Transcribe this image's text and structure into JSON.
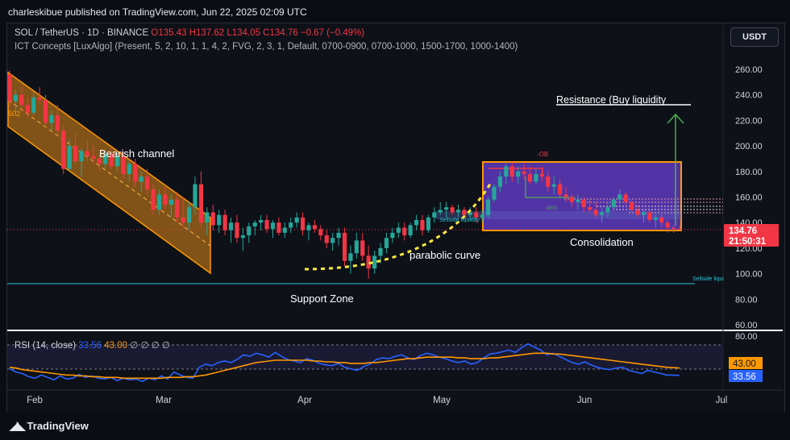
{
  "header": {
    "published": "charleskibue published on TradingView.com, Jun 22, 2025 02:09 UTC"
  },
  "legend": {
    "symbol": "SOL / TetherUS · 1D · BINANCE",
    "open": "O135.43",
    "high": "H137.62",
    "low": "L134.05",
    "close": "C134.76",
    "change": "−0.67 (−0.49%)",
    "indicator": "ICT Concepts [LuxAlgo] (Present, 5, 2, 10, 1, 1, 4, 2, FVG, 2, 3, 1, Default, 0700-0900, 0700-1000, 1500-1700, 1000-1400)"
  },
  "currency_button": "USDT",
  "annotations": {
    "bearish_channel": "Bearish channel",
    "support_zone": "Support Zone",
    "parabolic_curve": "parabolic curve",
    "consolidation": "Consolidation",
    "resistance": "Resistance (Buy liquidity",
    "ob": "-OB",
    "mss": "MSS",
    "sellside_liquidity": "Sellside liquidity",
    "sellside_liqui": "Sellside liqui",
    "fib_label": "502"
  },
  "price_badge": {
    "price": "134.76",
    "countdown": "21:50:31"
  },
  "rsi": {
    "label": "RSI (14, close)",
    "value": "33.56",
    "ma_value": "43.00",
    "extras": "∅ ∅ ∅ ∅",
    "badge_ma": "43.00",
    "badge_rsi": "33.56",
    "axis_top": "80.00"
  },
  "footer": {
    "brand": "TradingView"
  },
  "chart_data": {
    "type": "candlestick",
    "symbol": "SOL/USDT",
    "interval": "1D",
    "y_axis_ticks": [
      260,
      240,
      220,
      200,
      180,
      160,
      140,
      120,
      100,
      80,
      60
    ],
    "y_axis_tick_labels": [
      "260.00",
      "240.00",
      "220.00",
      "200.00",
      "180.00",
      "160.00",
      "140.00",
      "120.00",
      "100.00",
      "80.00",
      "60.00"
    ],
    "ylim": [
      55,
      272
    ],
    "x_tick_labels": [
      "Feb",
      "Mar",
      "Apr",
      "May",
      "Jun",
      "Jul"
    ],
    "last_price": 134.76,
    "candles": [
      [
        256,
        259,
        230,
        235
      ],
      [
        235,
        244,
        225,
        240
      ],
      [
        240,
        247,
        228,
        232
      ],
      [
        232,
        238,
        222,
        226
      ],
      [
        226,
        242,
        224,
        238
      ],
      [
        238,
        246,
        233,
        236
      ],
      [
        236,
        240,
        214,
        218
      ],
      [
        218,
        228,
        212,
        224
      ],
      [
        224,
        232,
        208,
        212
      ],
      [
        212,
        216,
        178,
        182
      ],
      [
        182,
        206,
        180,
        200
      ],
      [
        200,
        210,
        186,
        188
      ],
      [
        188,
        198,
        176,
        196
      ],
      [
        196,
        204,
        188,
        192
      ],
      [
        192,
        201,
        186,
        190
      ],
      [
        190,
        194,
        180,
        186
      ],
      [
        186,
        196,
        182,
        194
      ],
      [
        194,
        198,
        182,
        184
      ],
      [
        184,
        196,
        180,
        192
      ],
      [
        192,
        196,
        174,
        178
      ],
      [
        178,
        190,
        172,
        186
      ],
      [
        186,
        190,
        168,
        172
      ],
      [
        172,
        180,
        164,
        176
      ],
      [
        176,
        182,
        162,
        166
      ],
      [
        166,
        170,
        146,
        150
      ],
      [
        150,
        166,
        146,
        162
      ],
      [
        162,
        168,
        150,
        154
      ],
      [
        154,
        162,
        144,
        158
      ],
      [
        158,
        164,
        140,
        144
      ],
      [
        144,
        160,
        136,
        140
      ],
      [
        140,
        156,
        134,
        152
      ],
      [
        152,
        176,
        146,
        170
      ],
      [
        170,
        180,
        136,
        140
      ],
      [
        140,
        152,
        130,
        148
      ],
      [
        148,
        154,
        134,
        138
      ],
      [
        138,
        150,
        132,
        146
      ],
      [
        146,
        150,
        130,
        134
      ],
      [
        134,
        144,
        124,
        140
      ],
      [
        140,
        146,
        124,
        128
      ],
      [
        128,
        136,
        118,
        130
      ],
      [
        130,
        140,
        124,
        137
      ],
      [
        137,
        142,
        130,
        140
      ],
      [
        140,
        146,
        134,
        142
      ],
      [
        142,
        146,
        132,
        135
      ],
      [
        135,
        142,
        128,
        140
      ],
      [
        140,
        144,
        130,
        132
      ],
      [
        132,
        140,
        128,
        136
      ],
      [
        136,
        144,
        132,
        140
      ],
      [
        140,
        148,
        136,
        144
      ],
      [
        144,
        148,
        130,
        134
      ],
      [
        134,
        140,
        126,
        138
      ],
      [
        138,
        142,
        132,
        135
      ],
      [
        135,
        138,
        126,
        130
      ],
      [
        130,
        134,
        120,
        124
      ],
      [
        124,
        132,
        118,
        128
      ],
      [
        128,
        136,
        122,
        132
      ],
      [
        132,
        136,
        106,
        110
      ],
      [
        110,
        122,
        100,
        116
      ],
      [
        116,
        132,
        112,
        126
      ],
      [
        126,
        132,
        110,
        114
      ],
      [
        114,
        122,
        96,
        104
      ],
      [
        104,
        118,
        100,
        114
      ],
      [
        114,
        124,
        108,
        120
      ],
      [
        120,
        132,
        116,
        128
      ],
      [
        128,
        136,
        124,
        132
      ],
      [
        132,
        140,
        128,
        136
      ],
      [
        136,
        140,
        126,
        130
      ],
      [
        130,
        140,
        128,
        138
      ],
      [
        138,
        146,
        134,
        142
      ],
      [
        142,
        146,
        130,
        134
      ],
      [
        134,
        146,
        132,
        144
      ],
      [
        144,
        152,
        140,
        148
      ],
      [
        148,
        156,
        146,
        150
      ],
      [
        150,
        156,
        144,
        152
      ],
      [
        152,
        154,
        146,
        148
      ],
      [
        148,
        154,
        144,
        150
      ],
      [
        150,
        152,
        144,
        146
      ],
      [
        146,
        152,
        142,
        148
      ],
      [
        148,
        152,
        140,
        144
      ],
      [
        144,
        150,
        140,
        146
      ],
      [
        146,
        160,
        144,
        158
      ],
      [
        158,
        170,
        156,
        168
      ],
      [
        168,
        180,
        164,
        176
      ],
      [
        176,
        186,
        170,
        184
      ],
      [
        184,
        188,
        172,
        176
      ],
      [
        176,
        184,
        170,
        180
      ],
      [
        180,
        186,
        174,
        178
      ],
      [
        178,
        184,
        170,
        172
      ],
      [
        172,
        182,
        170,
        178
      ],
      [
        178,
        184,
        172,
        176
      ],
      [
        176,
        180,
        164,
        168
      ],
      [
        168,
        176,
        162,
        170
      ],
      [
        170,
        174,
        160,
        162
      ],
      [
        162,
        168,
        156,
        160
      ],
      [
        160,
        162,
        152,
        156
      ],
      [
        156,
        162,
        150,
        158
      ],
      [
        158,
        160,
        148,
        152
      ],
      [
        152,
        158,
        148,
        150
      ],
      [
        150,
        156,
        144,
        146
      ],
      [
        146,
        152,
        140,
        148
      ],
      [
        148,
        156,
        144,
        152
      ],
      [
        152,
        160,
        150,
        158
      ],
      [
        158,
        166,
        154,
        162
      ],
      [
        162,
        164,
        154,
        156
      ],
      [
        156,
        158,
        148,
        150
      ],
      [
        150,
        154,
        144,
        146
      ],
      [
        146,
        150,
        140,
        148
      ],
      [
        148,
        150,
        140,
        142
      ],
      [
        142,
        146,
        136,
        144
      ],
      [
        144,
        148,
        136,
        140
      ],
      [
        140,
        142,
        132,
        136
      ],
      [
        136,
        138,
        132,
        135
      ],
      [
        135,
        137.6,
        134.05,
        134.76
      ]
    ],
    "rsi_series": [
      {
        "name": "RSI",
        "values": [
          42,
          38,
          36,
          32,
          30,
          34,
          31,
          28,
          33,
          29,
          30,
          35,
          31,
          33,
          30,
          29,
          31,
          27,
          30,
          28,
          29,
          26,
          30,
          28,
          33,
          29,
          38,
          34,
          31,
          30,
          44,
          48,
          46,
          50,
          52,
          50,
          54,
          60,
          58,
          62,
          60,
          57,
          63,
          58,
          54,
          52,
          50,
          55,
          53,
          49,
          47,
          46,
          49,
          44,
          42,
          40,
          45,
          48,
          54,
          56,
          55,
          58,
          60,
          56,
          54,
          59,
          62,
          60,
          57,
          55,
          52,
          50,
          52,
          48,
          50,
          56,
          61,
          62,
          64,
          66,
          63,
          69,
          74,
          70,
          66,
          60,
          62,
          58,
          54,
          50,
          48,
          51,
          47,
          44,
          42,
          41,
          43,
          44,
          40,
          38,
          36,
          40,
          38,
          36,
          34,
          34,
          33.56
        ],
        "color": "#2962ff"
      },
      {
        "name": "RSI-based MA",
        "values": [
          44,
          43,
          41,
          40,
          39,
          38,
          37,
          36,
          35,
          34,
          34,
          33,
          33,
          32,
          32,
          31,
          31,
          31,
          30,
          30,
          30,
          30,
          30,
          30,
          30,
          31,
          31,
          31,
          32,
          32,
          33,
          34,
          36,
          38,
          40,
          42,
          44,
          46,
          48,
          50,
          51,
          52,
          53,
          53,
          53,
          53,
          53,
          53,
          52,
          52,
          51,
          51,
          50,
          50,
          49,
          49,
          49,
          50,
          50,
          51,
          52,
          53,
          54,
          55,
          55,
          56,
          57,
          57,
          57,
          57,
          57,
          56,
          56,
          55,
          55,
          55,
          56,
          56,
          57,
          58,
          59,
          60,
          61,
          62,
          62,
          62,
          61,
          61,
          60,
          59,
          58,
          57,
          56,
          55,
          54,
          53,
          52,
          51,
          50,
          49,
          48,
          47,
          46,
          45,
          44,
          43.5,
          43
        ],
        "color": "#ff9800"
      }
    ],
    "rsi_ylim": [
      20,
      84
    ]
  }
}
